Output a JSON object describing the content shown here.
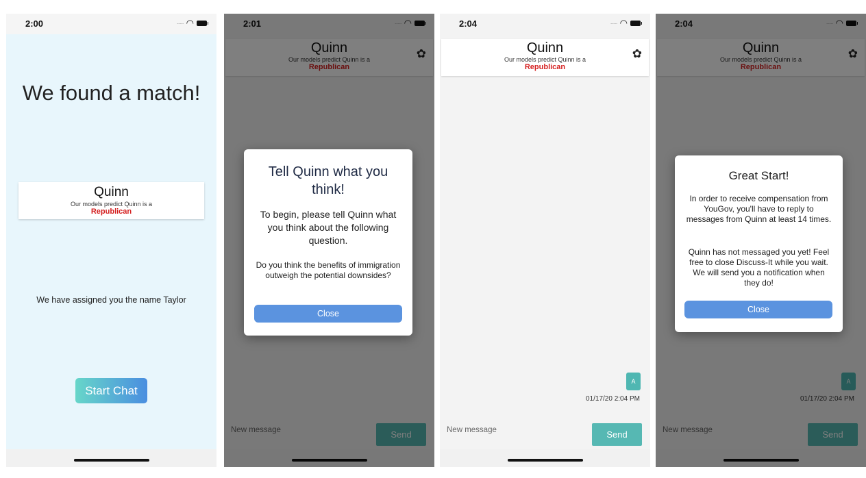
{
  "profile": {
    "name": "Quinn",
    "prediction_text": "Our models predict Quinn is a",
    "party": "Republican"
  },
  "screen1": {
    "time": "2:00",
    "title": "We found a match!",
    "assigned_text": "We have assigned you the name Taylor",
    "start_button": "Start Chat"
  },
  "screen2": {
    "time": "2:01",
    "modal": {
      "title": "Tell Quinn what you think!",
      "body": "To begin, please tell Quinn what you think about the following question.",
      "question": "Do you think the benefits of immigration outweigh the potential downsides?",
      "close_button": "Close"
    }
  },
  "screen3": {
    "time": "2:04",
    "message_avatar": "A",
    "message_timestamp": "01/17/20 2:04 PM"
  },
  "screen4": {
    "time": "2:04",
    "message_avatar": "A",
    "message_timestamp": "01/17/20 2:04 PM",
    "modal": {
      "title": "Great Start!",
      "body": "In order to receive compensation from YouGov, you'll have to reply to messages from Quinn at least 14 times.",
      "body2": "Quinn has not messaged you yet! Feel free to close Discuss-It while you wait. We will send you a notification when they do!",
      "close_button": "Close"
    }
  },
  "composer": {
    "placeholder": "New message",
    "send_button": "Send"
  },
  "icons": {
    "settings": "gear-icon",
    "wifi": "wifi-icon",
    "battery": "battery-icon"
  },
  "colors": {
    "party": "#d42020",
    "send": "#56b8b3",
    "modal_button": "#5b93df",
    "match_background": "#e8f6fc"
  }
}
